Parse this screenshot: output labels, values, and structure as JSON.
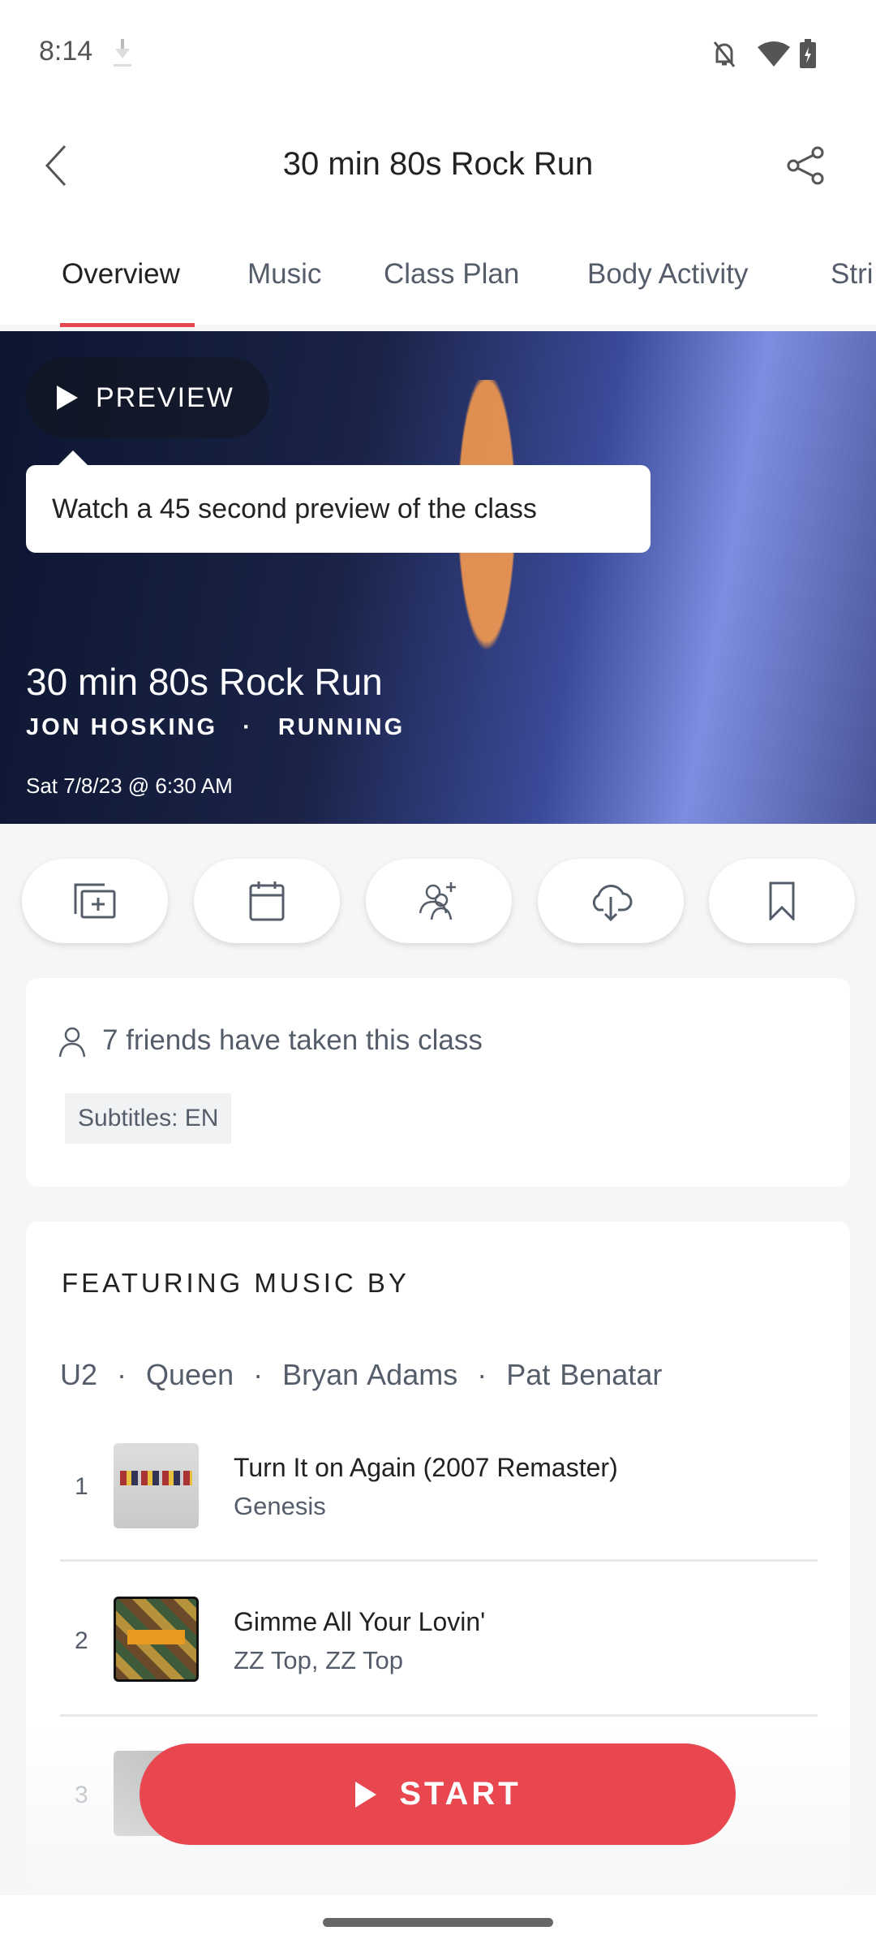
{
  "status_bar": {
    "time": "8:14",
    "icons": [
      "download-icon",
      "bell-off-icon",
      "wifi-icon",
      "battery-charging-icon"
    ]
  },
  "header": {
    "title": "30 min 80s Rock Run",
    "back_icon": "chevron-left-icon",
    "share_icon": "share-icon"
  },
  "tabs": [
    {
      "label": "Overview",
      "active": true
    },
    {
      "label": "Music"
    },
    {
      "label": "Class Plan"
    },
    {
      "label": "Body Activity"
    },
    {
      "label": "Stri"
    }
  ],
  "hero": {
    "preview_label": "PREVIEW",
    "tooltip": "Watch a 45 second preview of the class",
    "title": "30 min 80s Rock Run",
    "instructor": "JON HOSKING",
    "separator": "·",
    "category": "RUNNING",
    "date": "Sat 7/8/23 @ 6:30 AM"
  },
  "actions": [
    "add-to-stack-icon",
    "calendar-icon",
    "invite-friend-icon",
    "download-cloud-icon",
    "bookmark-icon"
  ],
  "info": {
    "friends": "7 friends have taken this class",
    "subtitles": "Subtitles: EN"
  },
  "music": {
    "heading": "FEATURING MUSIC BY",
    "artists": "U2  ·  Queen  ·  Bryan Adams  ·  Pat Benatar",
    "tracks": [
      {
        "num": "1",
        "title": "Turn It on Again (2007 Remaster)",
        "artist": "Genesis"
      },
      {
        "num": "2",
        "title": "Gimme All Your Lovin'",
        "artist": "ZZ Top, ZZ Top"
      },
      {
        "num": "3",
        "title": "",
        "artist": ""
      }
    ]
  },
  "start_label": "START",
  "colors": {
    "accent": "#e8474f",
    "text_secondary": "#555d6b"
  }
}
